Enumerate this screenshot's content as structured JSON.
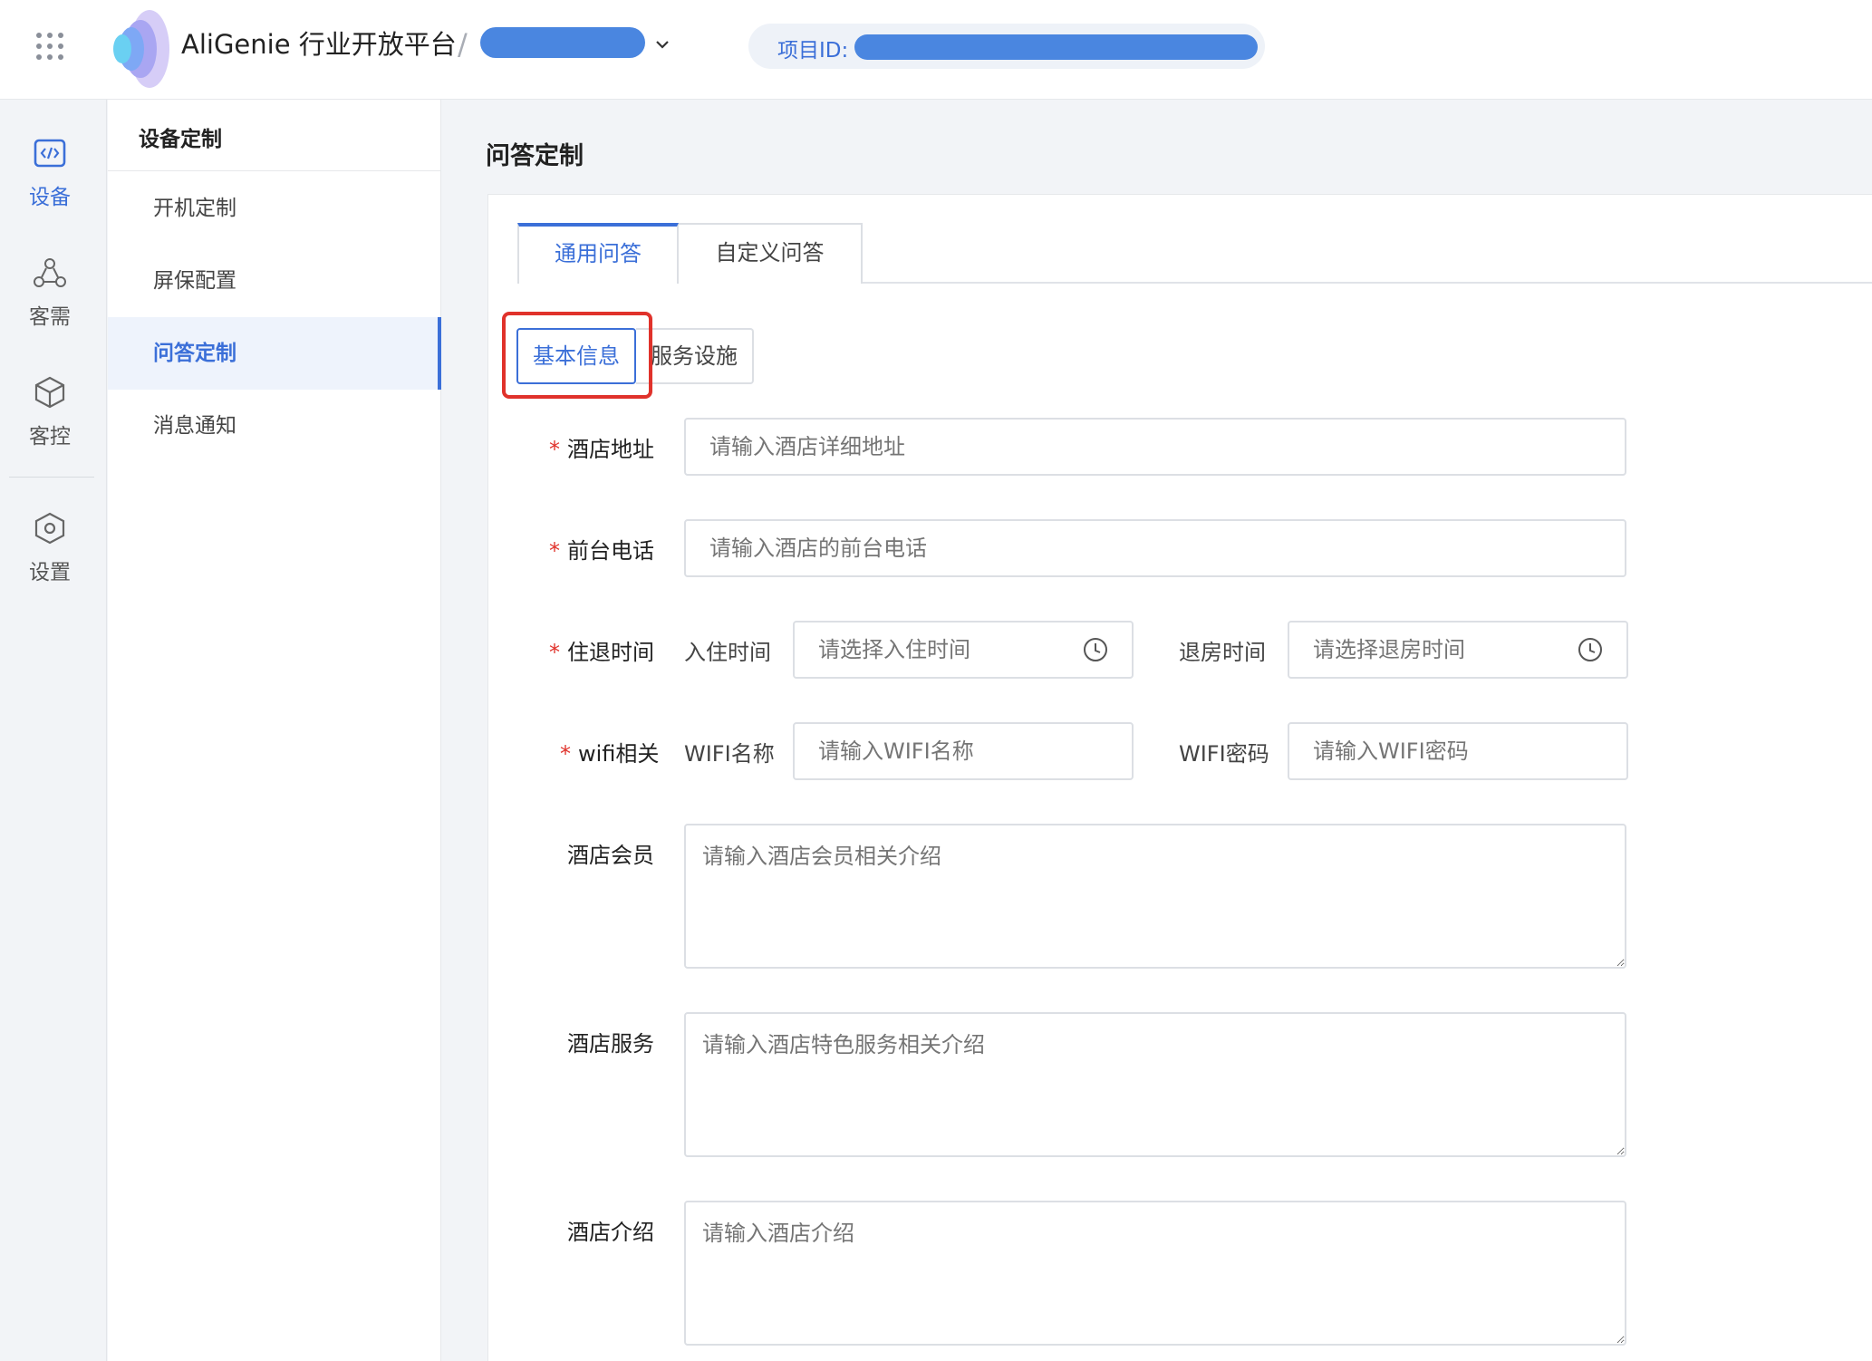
{
  "header": {
    "brand": "AliGenie 行业开放平台",
    "separator": "/",
    "project_id_label": "项目ID:"
  },
  "rail": {
    "items": [
      {
        "label": "设备",
        "icon": "code-device-icon",
        "active": true
      },
      {
        "label": "客需",
        "icon": "people-network-icon",
        "active": false
      },
      {
        "label": "客控",
        "icon": "cube-icon",
        "active": false
      },
      {
        "label": "设置",
        "icon": "hex-settings-icon",
        "active": false
      }
    ]
  },
  "subnav": {
    "title": "设备定制",
    "items": [
      {
        "label": "开机定制",
        "active": false
      },
      {
        "label": "屏保配置",
        "active": false
      },
      {
        "label": "问答定制",
        "active": true
      },
      {
        "label": "消息通知",
        "active": false
      }
    ]
  },
  "main": {
    "title": "问答定制",
    "tabs": [
      {
        "label": "通用问答",
        "active": true
      },
      {
        "label": "自定义问答",
        "active": false
      }
    ],
    "subtabs": [
      {
        "label": "基本信息",
        "active": true
      },
      {
        "label": "服务设施",
        "active": false
      }
    ]
  },
  "form": {
    "required_mark": "*",
    "address": {
      "label": "酒店地址",
      "placeholder": "请输入酒店详细地址",
      "value": ""
    },
    "phone": {
      "label": "前台电话",
      "placeholder": "请输入酒店的前台电话",
      "value": ""
    },
    "checkin_out": {
      "label": "住退时间",
      "checkin_label": "入住时间",
      "checkin_placeholder": "请选择入住时间",
      "checkout_label": "退房时间",
      "checkout_placeholder": "请选择退房时间"
    },
    "wifi": {
      "label": "wifi相关",
      "name_label": "WIFI名称",
      "name_placeholder": "请输入WIFI名称",
      "password_label": "WIFI密码",
      "password_placeholder": "请输入WIFI密码"
    },
    "membership": {
      "label": "酒店会员",
      "placeholder": "请输入酒店会员相关介绍"
    },
    "services": {
      "label": "酒店服务",
      "placeholder": "请输入酒店特色服务相关介绍"
    },
    "intro": {
      "label": "酒店介绍",
      "placeholder": "请输入酒店介绍"
    }
  },
  "colors": {
    "accent": "#3b6fd8",
    "highlight": "#e0322b",
    "redacted": "#4a86e0"
  }
}
